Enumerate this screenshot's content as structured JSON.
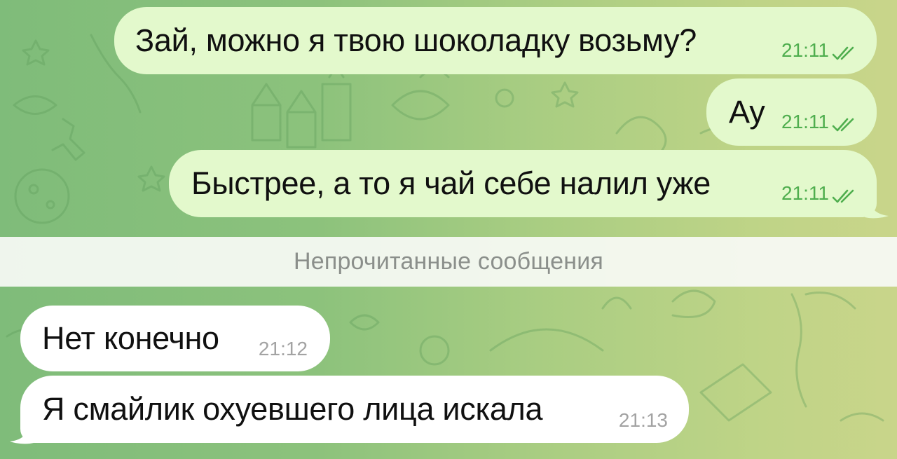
{
  "chat": {
    "outgoing": [
      {
        "text": "Зай, можно я твою шоколадку возьму?",
        "time": "21:11",
        "status_icon": "double-check-icon"
      },
      {
        "text": "Ау",
        "time": "21:11",
        "status_icon": "double-check-icon"
      },
      {
        "text": "Быстрее, а то я чай себе налил уже",
        "time": "21:11",
        "status_icon": "double-check-icon"
      }
    ],
    "unread_divider": "Непрочитанные сообщения",
    "incoming": [
      {
        "text": "Нет конечно",
        "time": "21:12"
      },
      {
        "text": "Я смайлик охуевшего лица искала",
        "time": "21:13"
      }
    ]
  },
  "colors": {
    "outgoing_bubble": "#e3f9cc",
    "incoming_bubble": "#ffffff",
    "read_tick": "#4fae4e",
    "background_left": "#7fbc7a",
    "background_right": "#c9d58a"
  }
}
